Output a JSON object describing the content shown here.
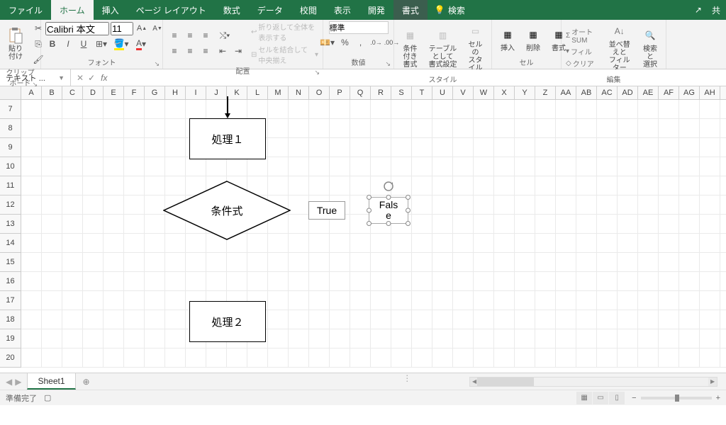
{
  "tabs": [
    "ファイル",
    "ホーム",
    "挿入",
    "ページ レイアウト",
    "数式",
    "データ",
    "校閲",
    "表示",
    "開発",
    "書式"
  ],
  "activeTab": "ホーム",
  "contextTab": "書式",
  "searchPlaceholder": "検索",
  "share": "共",
  "groups": {
    "clipboard": {
      "label": "クリップボード",
      "paste": "貼り付け"
    },
    "font": {
      "label": "フォント",
      "name": "Calibri 本文",
      "size": "11",
      "bold": "B",
      "italic": "I",
      "underline": "U"
    },
    "alignment": {
      "label": "配置",
      "wrap": "折り返して全体を表示する",
      "merge": "セルを結合して中央揃え"
    },
    "number": {
      "label": "数値",
      "format": "標準"
    },
    "styles": {
      "label": "スタイル",
      "cond": "条件付き\n書式",
      "table": "テーブルとして\n書式設定",
      "cell": "セルの\nスタイル"
    },
    "cells": {
      "label": "セル",
      "insert": "挿入",
      "delete": "削除",
      "format": "書式"
    },
    "editing": {
      "label": "編集",
      "sum": "オート SUM",
      "fill": "フィル",
      "clear": "クリア",
      "sort": "並べ替えと\nフィルター",
      "find": "検索と\n選択"
    }
  },
  "namebox": "テキスト ...",
  "fx": "fx",
  "columns": [
    "A",
    "B",
    "C",
    "D",
    "E",
    "F",
    "G",
    "H",
    "I",
    "J",
    "K",
    "L",
    "M",
    "N",
    "O",
    "P",
    "Q",
    "R",
    "S",
    "T",
    "U",
    "V",
    "W",
    "X",
    "Y",
    "Z",
    "AA",
    "AB",
    "AC",
    "AD",
    "AE",
    "AF",
    "AG",
    "AH",
    "A"
  ],
  "rows": [
    "7",
    "8",
    "9",
    "10",
    "11",
    "12",
    "13",
    "14",
    "15",
    "16",
    "17",
    "18",
    "19",
    "20"
  ],
  "shapes": {
    "process1": "処理１",
    "decision": "条件式",
    "process2": "処理２",
    "trueLabel": "True",
    "falseLabel": "Fals\ne"
  },
  "sheetTab": "Sheet1",
  "status": "準備完了",
  "zoom": "100%"
}
